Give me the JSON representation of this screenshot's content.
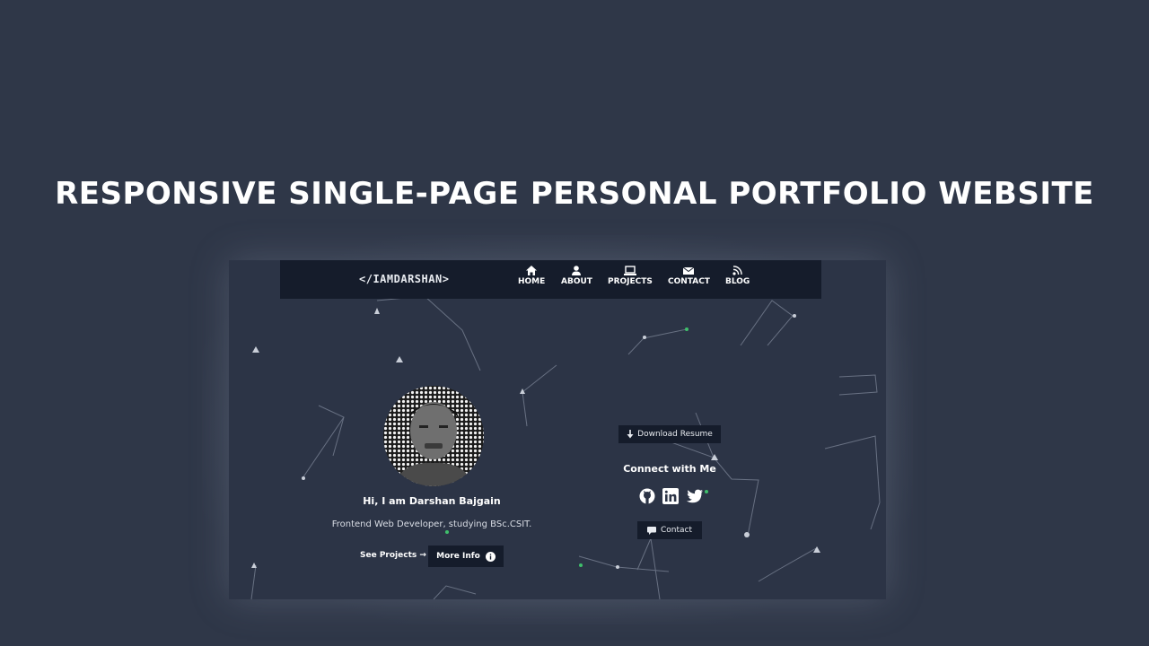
{
  "banner": {
    "title": "RESPONSIVE SINGLE-PAGE PERSONAL PORTFOLIO WEBSITE"
  },
  "site": {
    "logo": "</IAMDARSHAN>",
    "nav": [
      {
        "label": "HOME",
        "icon": "home-icon"
      },
      {
        "label": "ABOUT",
        "icon": "user-icon"
      },
      {
        "label": "PROJECTS",
        "icon": "laptop-icon"
      },
      {
        "label": "CONTACT",
        "icon": "envelope-icon"
      },
      {
        "label": "BLOG",
        "icon": "rss-icon"
      }
    ]
  },
  "hero": {
    "greeting": "Hi, I am Darshan Bajgain",
    "subtitle": "Frontend Web Developer, studying BSc.CSIT.",
    "see_projects": "See Projects →",
    "more_info": "More Info"
  },
  "sidebar": {
    "download_resume": "Download Resume",
    "connect_heading": "Connect with Me",
    "social": [
      "github-icon",
      "linkedin-icon",
      "twitter-icon"
    ],
    "contact_button": "Contact"
  },
  "colors": {
    "background": "#2f3748",
    "frame": "#2c3446",
    "navbar": "#151c2b",
    "button": "#151c2b",
    "accent_green": "#3fbf6b"
  }
}
